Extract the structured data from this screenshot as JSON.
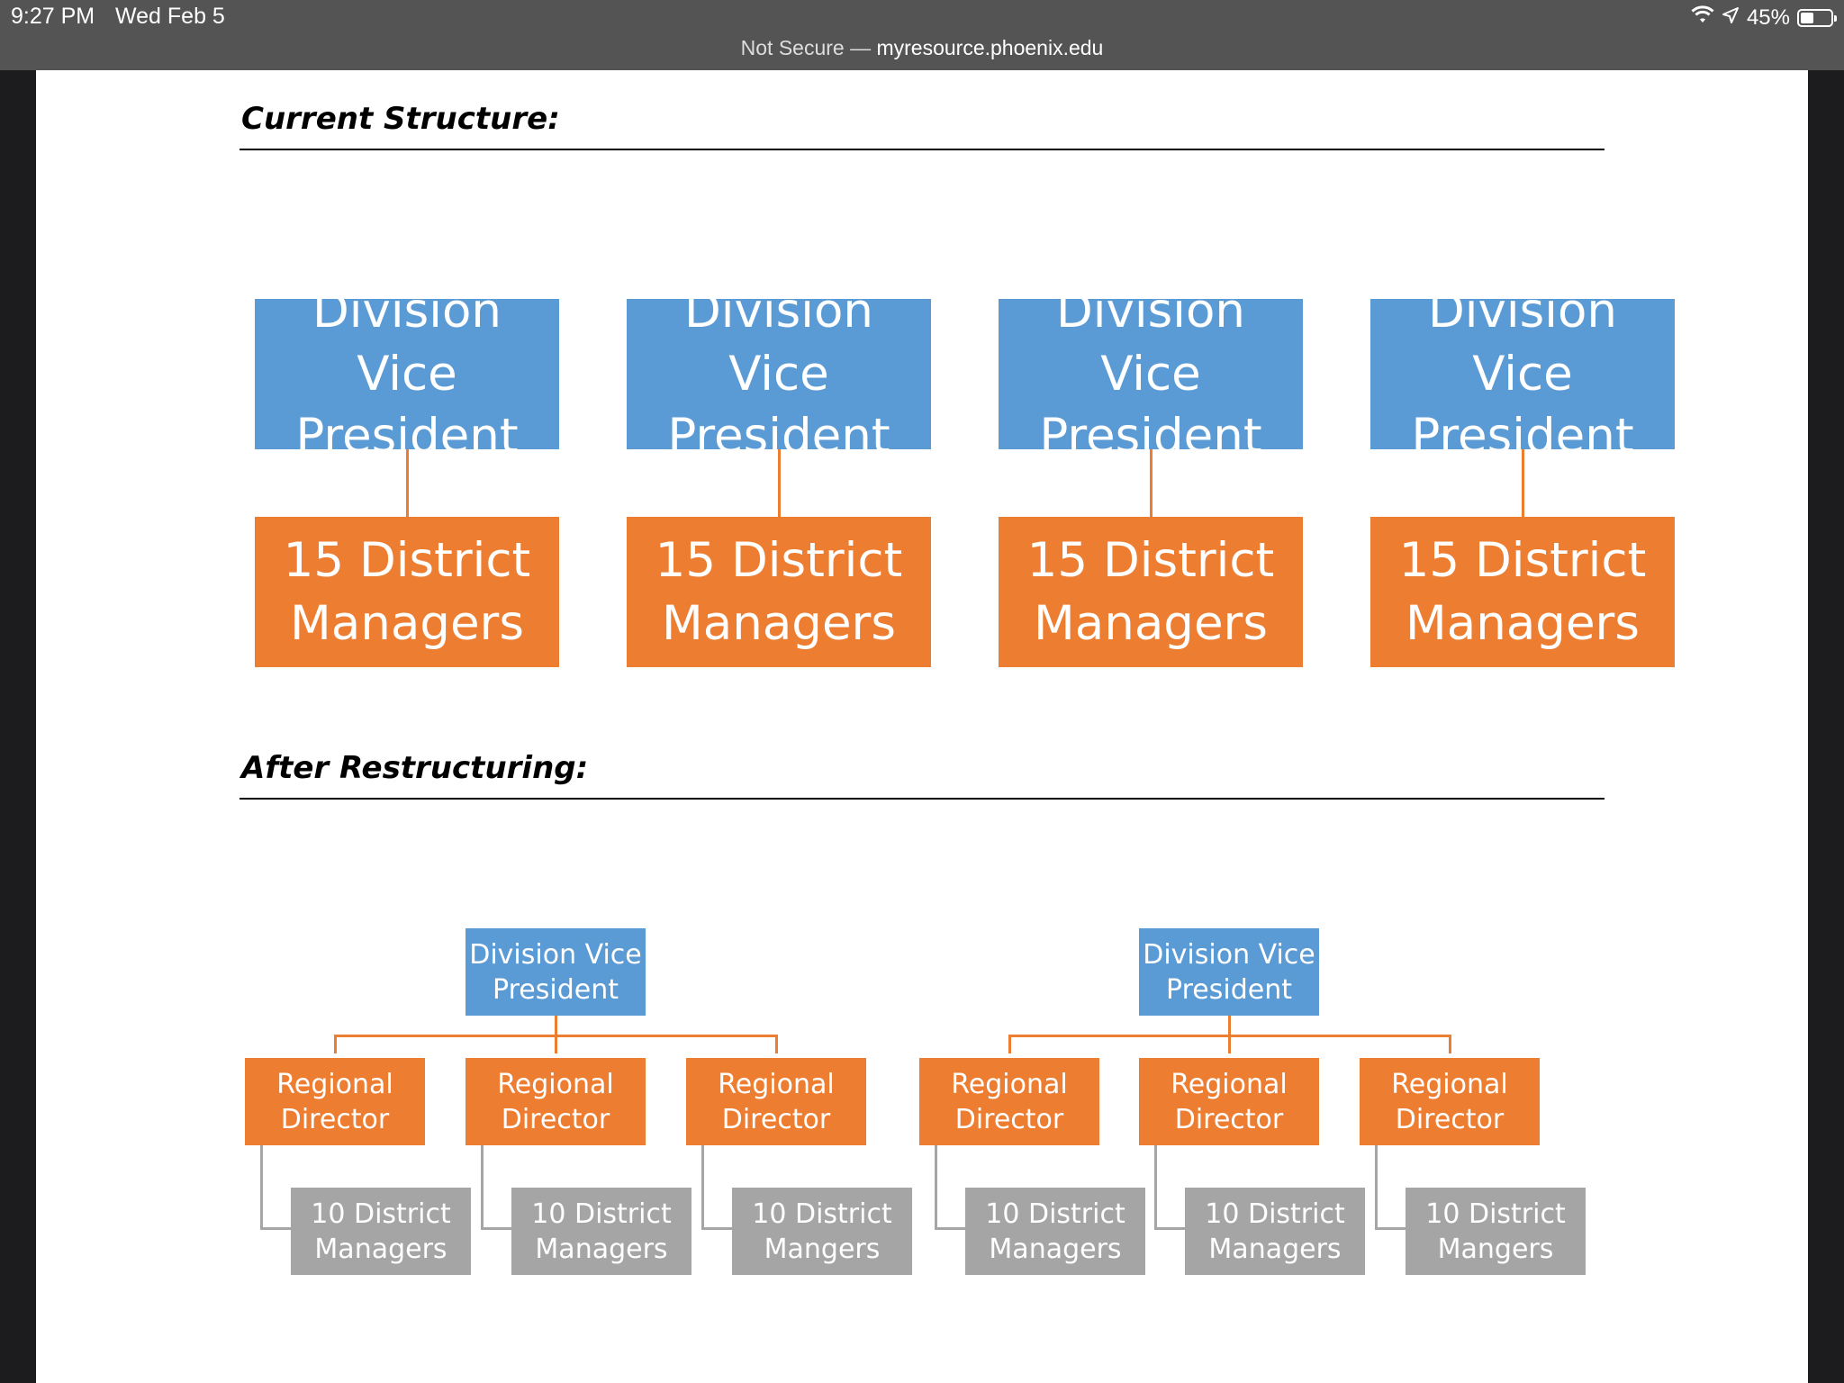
{
  "status_bar": {
    "time": "9:27 PM",
    "date": "Wed Feb 5",
    "battery_percent": "45%",
    "battery_level": 0.45,
    "security": "Not Secure —",
    "host": "myresource.phoenix.edu",
    "icons": [
      "wifi-icon",
      "location-arrow-icon",
      "battery-icon"
    ]
  },
  "colors": {
    "blue": "#5b9bd5",
    "orange": "#ed7d31",
    "gray": "#a5a5a5"
  },
  "current": {
    "heading": "Current Structure:",
    "units": [
      {
        "top": "Division Vice President",
        "bottom": "15 District Managers"
      },
      {
        "top": "Division Vice President",
        "bottom": "15 District Managers"
      },
      {
        "top": "Division Vice President",
        "bottom": "15 District Managers"
      },
      {
        "top": "Division Vice President",
        "bottom": "15 District Managers"
      }
    ]
  },
  "after": {
    "heading": "After Restructuring:",
    "trees": [
      {
        "root": "Division Vice President",
        "children": [
          {
            "label": "Regional Director",
            "sub": "10 District Managers"
          },
          {
            "label": "Regional Director",
            "sub": "10 District Managers"
          },
          {
            "label": "Regional Director",
            "sub": "10 District Mangers"
          }
        ]
      },
      {
        "root": "Division Vice President",
        "children": [
          {
            "label": "Regional Director",
            "sub": "10 District Managers"
          },
          {
            "label": "Regional Director",
            "sub": "10 District Managers"
          },
          {
            "label": "Regional Director",
            "sub": "10 District Mangers"
          }
        ]
      }
    ]
  }
}
